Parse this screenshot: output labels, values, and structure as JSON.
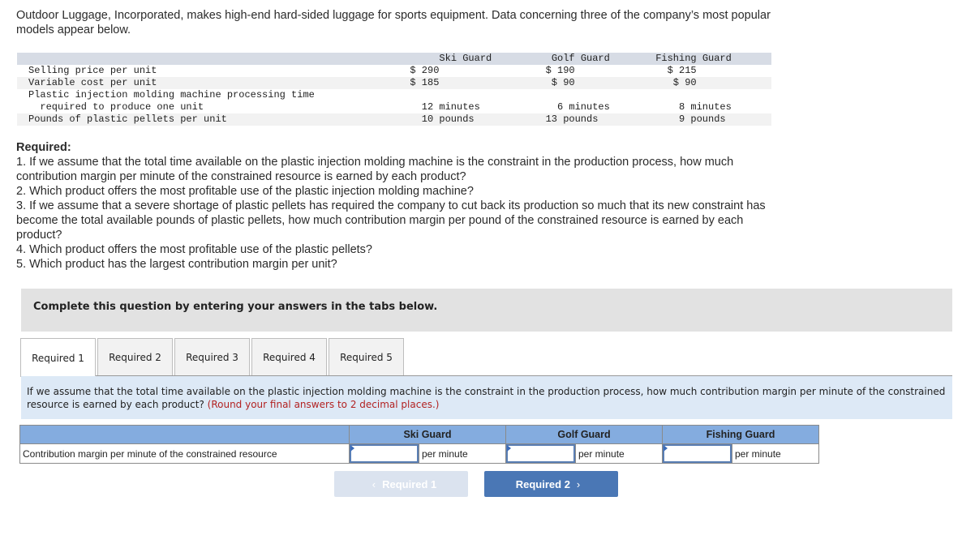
{
  "intro": "Outdoor Luggage, Incorporated, makes high-end hard-sided luggage for sports equipment. Data concerning three of the company’s most popular models appear below.",
  "data_table": {
    "columns": [
      "Ski Guard",
      "Golf Guard",
      "Fishing Guard"
    ],
    "rows": [
      {
        "label": "Selling price per unit",
        "values": [
          "$ 290",
          "$ 190",
          "$ 215"
        ]
      },
      {
        "label": "Variable cost per unit",
        "values": [
          "$ 185",
          " $ 90",
          " $ 90"
        ]
      },
      {
        "label": "Plastic injection molding machine processing time",
        "values": [
          "",
          "",
          ""
        ]
      },
      {
        "label": "  required to produce one unit",
        "values": [
          "    12 minutes",
          "     6 minutes",
          "     8 minutes"
        ]
      },
      {
        "label": "Pounds of plastic pellets per unit",
        "values": [
          "    10 pounds",
          "   13 pounds",
          "     9 pounds"
        ]
      }
    ]
  },
  "required": {
    "title": "Required:",
    "items": [
      "1. If we assume that the total time available on the plastic injection molding machine is the constraint in the production process, how much contribution margin per minute of the constrained resource is earned by each product?",
      "2. Which product offers the most profitable use of the plastic injection molding machine?",
      "3. If we assume that a severe shortage of plastic pellets has required the company to cut back its production so much that its new constraint has become the total available pounds of plastic pellets, how much contribution margin per pound of the constrained resource is earned by each product?",
      "4. Which product offers the most profitable use of the plastic pellets?",
      "5. Which product has the largest contribution margin per unit?"
    ]
  },
  "complete_bar": "Complete this question by entering your answers in the tabs below.",
  "tabs": [
    {
      "label": "Required 1",
      "active": true
    },
    {
      "label": "Required 2",
      "active": false
    },
    {
      "label": "Required 3",
      "active": false
    },
    {
      "label": "Required 4",
      "active": false
    },
    {
      "label": "Required 5",
      "active": false
    }
  ],
  "instructions": {
    "text": "If we assume that the total time available on the plastic injection molding machine is the constraint in the production process, how much contribution margin per minute of the constrained resource is earned by each product?",
    "hint": "(Round your final answers to 2 decimal places.)"
  },
  "answer_table": {
    "headers": [
      "",
      "Ski Guard",
      "Golf Guard",
      "Fishing Guard"
    ],
    "row_label": "Contribution margin per minute of the constrained resource",
    "inputs": [
      {
        "value": "",
        "unit": "per minute"
      },
      {
        "value": "",
        "unit": "per minute"
      },
      {
        "value": "",
        "unit": "per minute"
      }
    ]
  },
  "nav": {
    "prev_label": "Required 1",
    "next_label": "Required 2",
    "prev_icon": "chevron-left-icon",
    "next_icon": "chevron-right-icon"
  },
  "colors": {
    "table_header": "#84acdf",
    "next_button": "#4a77b5",
    "prev_button_disabled": "#dbe3ef",
    "hint": "#b22222",
    "instructions_bg": "#dde9f6"
  }
}
